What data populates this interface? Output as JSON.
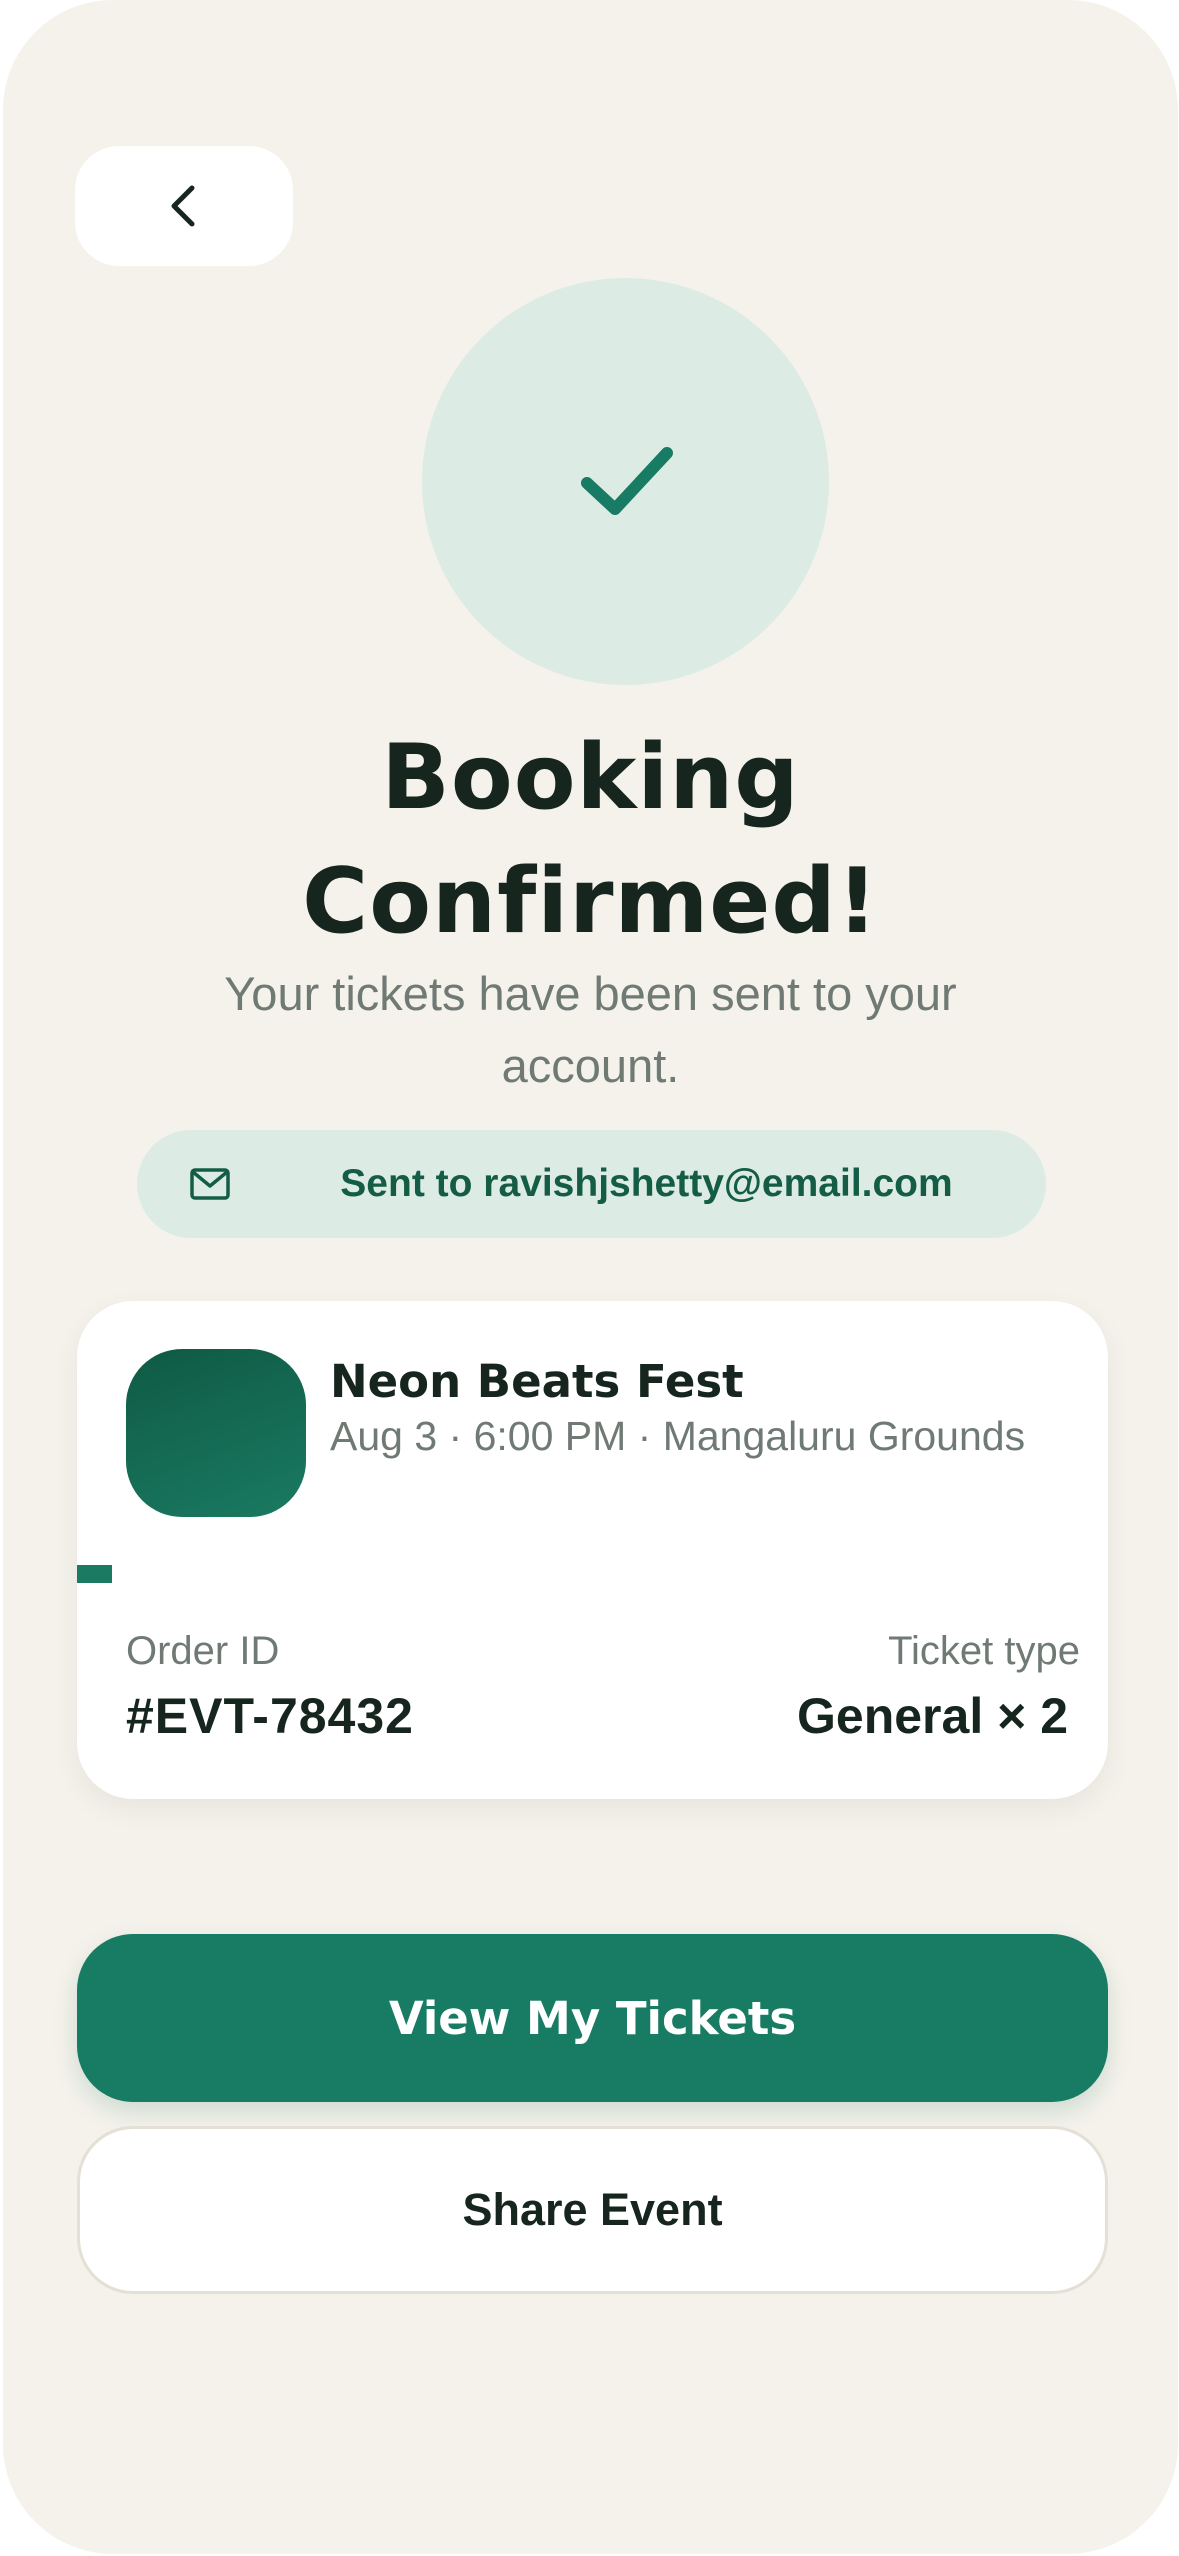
{
  "header": {
    "back_icon": "chevron-left-icon"
  },
  "hero": {
    "icon": "check-icon",
    "title_line1": "Booking",
    "title_line2": "Confirmed!",
    "subtitle": "Your tickets have been sent to your account."
  },
  "email_notice": {
    "icon": "mail-icon",
    "text": "Sent to ravishjshetty@email.com"
  },
  "event": {
    "name": "Neon Beats Fest",
    "meta": "Aug 3 · 6:00 PM · Mangaluru Grounds",
    "order_label": "Order ID",
    "order_value": "#EVT-78432",
    "ticket_label": "Ticket type",
    "ticket_value": "General × 2"
  },
  "actions": {
    "primary_label": "View My Tickets",
    "secondary_label": "Share Event"
  },
  "colors": {
    "background": "#f5f2eb",
    "accent": "#187b63",
    "accent_light": "#dcece5",
    "text_dark": "#17251f",
    "text_muted": "#707a74"
  }
}
